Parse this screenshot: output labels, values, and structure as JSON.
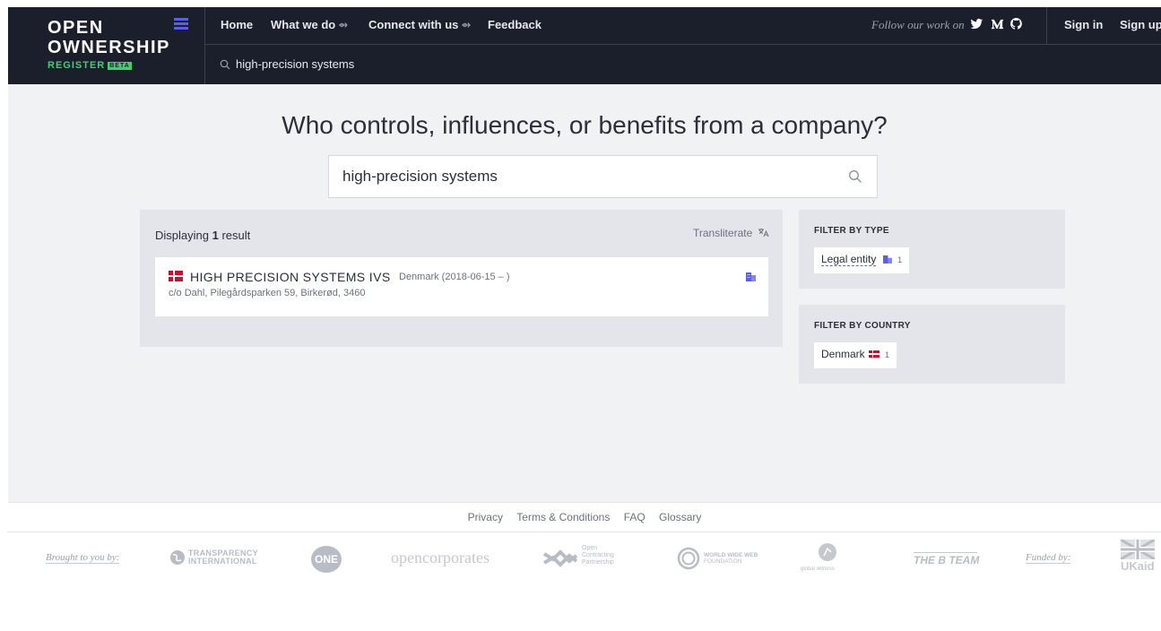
{
  "logo": {
    "line1": "OPEN",
    "line2": "OWNERSHIP",
    "line3": "REGISTER",
    "beta": "BETA"
  },
  "nav": {
    "home": "Home",
    "what_we_do": "What we do",
    "connect": "Connect with us",
    "feedback": "Feedback",
    "follow": "Follow our work on",
    "sign_in": "Sign in",
    "sign_up": "Sign up",
    "search_value": "high-precision systems",
    "arrow": "⇴"
  },
  "hero": {
    "title": "Who controls, influences, or benefits from a company?",
    "search_value": "high-precision systems"
  },
  "results": {
    "displaying_prefix": "Displaying",
    "count": "1",
    "displaying_suffix": "result",
    "transliterate": "Transliterate",
    "items": [
      {
        "name": "HIGH PRECISION SYSTEMS IVS",
        "meta": "Denmark (2018-06-15 – )",
        "address": "c/o Dahl, Pilegårdsparken 59, Birkerød, 3460"
      }
    ]
  },
  "filters": {
    "type": {
      "title": "FILTER BY TYPE",
      "label": "Legal entity",
      "count": "1"
    },
    "country": {
      "title": "FILTER BY COUNTRY",
      "label": "Denmark",
      "count": "1"
    }
  },
  "footer": {
    "links": [
      "Privacy",
      "Terms & Conditions",
      "FAQ",
      "Glossary"
    ],
    "brought": "Brought to you by:",
    "funded": "Funded by:",
    "sponsors": {
      "ti_line1": "TRANSPARENCY",
      "ti_line2": "INTERNATIONAL",
      "one": "ONE",
      "opencorporates": "opencorporates",
      "ocp_line1": "Open",
      "ocp_line2": "Contracting",
      "ocp_line3": "Partnership",
      "www_line1": "WORLD WIDE WEB",
      "www_line2": "FOUNDATION",
      "gw": "global witness",
      "bteam": "THE B TEAM",
      "ukaid": "UKaid"
    }
  },
  "colors": {
    "header_bg": "#1b1f2b",
    "accent_green": "#3cd070",
    "accent_purple": "#5b5fe8",
    "denmark_red": "#c8102e"
  },
  "icons": [
    "twitter-icon",
    "medium-icon",
    "github-icon",
    "search-icon",
    "transliterate-icon",
    "legal-entity-icon",
    "denmark-flag-icon"
  ]
}
